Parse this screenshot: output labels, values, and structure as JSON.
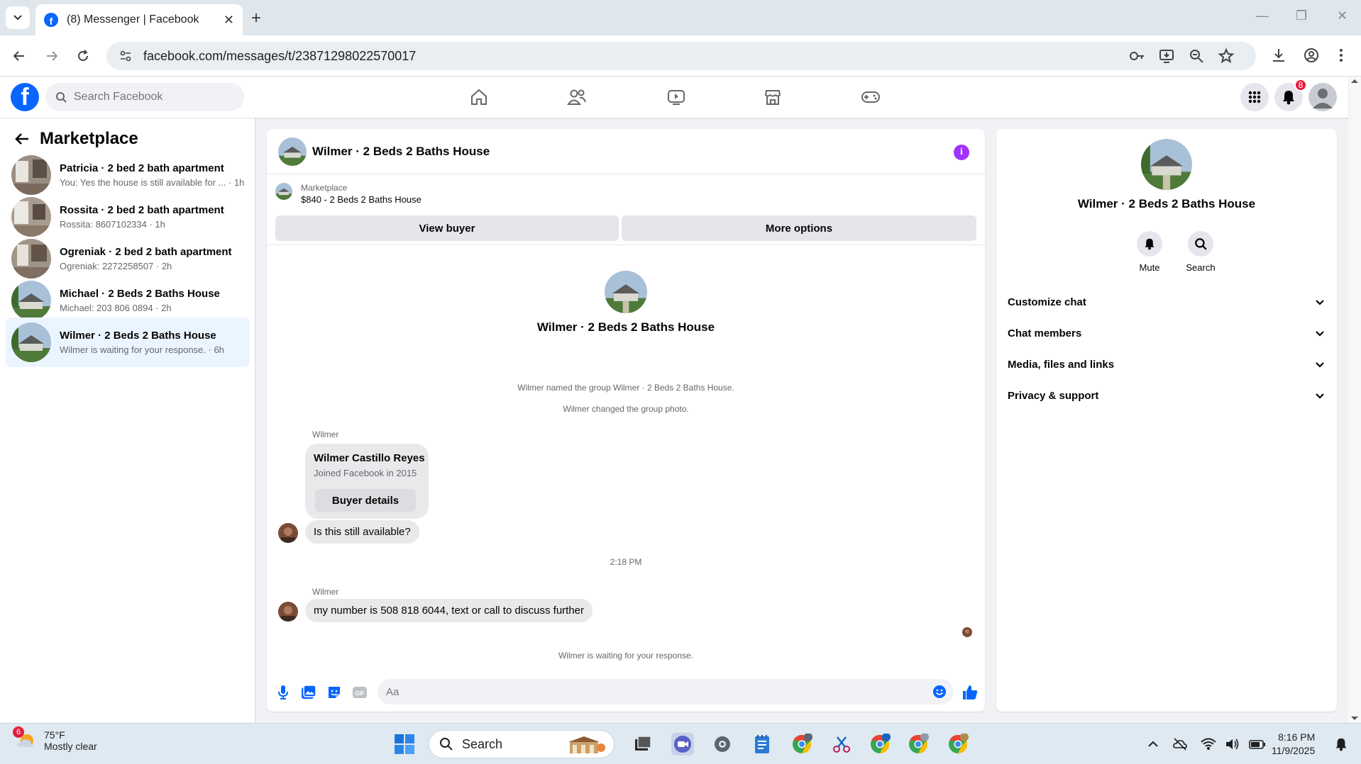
{
  "browser": {
    "tab_title": "(8) Messenger | Facebook",
    "url": "facebook.com/messages/t/23871298022570017"
  },
  "fb": {
    "search_placeholder": "Search Facebook",
    "notification_count": "8"
  },
  "sidebar": {
    "title": "Marketplace",
    "conversations": [
      {
        "name": "Patricia · 2 bed 2 bath apartment",
        "snippet": "You: Yes the house is still available for ... · 1h"
      },
      {
        "name": "Rossita · 2 bed 2 bath apartment",
        "snippet": "Rossita: 8607102334 · 1h"
      },
      {
        "name": "Ogreniak · 2 bed 2 bath apartment",
        "snippet": "Ogreniak: 2272258507 · 2h"
      },
      {
        "name": "Michael · 2 Beds 2 Baths House",
        "snippet": "Michael: 203 806 0894 · 2h"
      },
      {
        "name": "Wilmer · 2 Beds 2 Baths House",
        "snippet": "Wilmer is waiting for your response. · 6h"
      }
    ]
  },
  "chat": {
    "title": "Wilmer · 2 Beds 2 Baths House",
    "marketplace_label": "Marketplace",
    "listing": "$840 - 2 Beds 2 Baths House",
    "view_buyer": "View buyer",
    "more_options": "More options",
    "profile_name": "Wilmer · 2 Beds 2 Baths House",
    "system_1": "Wilmer named the group Wilmer · 2 Beds 2 Baths House.",
    "system_2": "Wilmer changed the group photo.",
    "sender_1": "Wilmer",
    "card_name": "Wilmer Castillo Reyes",
    "card_joined": "Joined Facebook in 2015",
    "card_button": "Buyer details",
    "msg_1": "Is this still available?",
    "timestamp": "2:18 PM",
    "sender_2": "Wilmer",
    "msg_2": "my number is 508 818 6044, text or call to discuss further",
    "waiting": "Wilmer is waiting for your response.",
    "composer_placeholder": "Aa"
  },
  "info_panel": {
    "name": "Wilmer · 2 Beds 2 Baths House",
    "mute": "Mute",
    "search": "Search",
    "sections": [
      "Customize chat",
      "Chat members",
      "Media, files and links",
      "Privacy & support"
    ]
  },
  "taskbar": {
    "weather_badge": "6",
    "temp": "75°F",
    "condition": "Mostly clear",
    "search": "Search",
    "time": "8:16 PM",
    "date": "11/9/2025"
  },
  "colors": {
    "fb_blue": "#0866ff",
    "messenger_purple": "#a033ff",
    "active_row": "#ebf5ff",
    "notification_red": "#e41e3f"
  }
}
